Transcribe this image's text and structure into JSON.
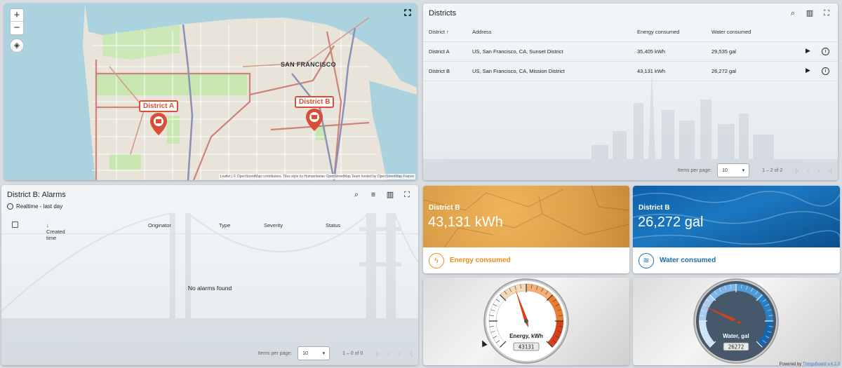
{
  "map": {
    "zoom_in": "+",
    "zoom_out": "−",
    "city_label": "SAN FRANCISCO",
    "attribution": "Leaflet | © OpenStreetMap contributors. Tiles style by Humanitarian OpenStreetMap Team hosted by OpenStreetMap France",
    "markers": [
      {
        "label": "District A"
      },
      {
        "label": "District B"
      }
    ],
    "marker_color": "#d65037"
  },
  "districts": {
    "title": "Districts",
    "columns": {
      "district": "District",
      "address": "Address",
      "energy": "Energy consumed",
      "water": "Water consumed"
    },
    "rows": [
      {
        "district": "District A",
        "address": "US, San Francisco, CA, Sunset District",
        "energy": "35,405 kWh",
        "water": "29,535 gal"
      },
      {
        "district": "District B",
        "address": "US, San Francisco, CA, Mission District",
        "energy": "43,131 kWh",
        "water": "26,272 gal"
      }
    ],
    "pagination": {
      "label": "Items per page:",
      "page_size": "10",
      "range": "1 – 2 of 2"
    }
  },
  "alarms": {
    "title": "District B: Alarms",
    "timewindow": "Realtime - last day",
    "columns": {
      "created": "Created time",
      "originator": "Originator",
      "type": "Type",
      "severity": "Severity",
      "status": "Status"
    },
    "empty": "No alarms found",
    "pagination": {
      "label": "Items per page:",
      "page_size": "10",
      "range": "1 – 0 of 0"
    }
  },
  "energy_card": {
    "district": "District B",
    "value": "43,131 kWh",
    "label": "Energy consumed",
    "color": "#f08a16"
  },
  "water_card": {
    "district": "District B",
    "value": "26,272 gal",
    "label": "Water consumed",
    "color": "#1a6ea8"
  },
  "energy_gauge": {
    "title": "Energy, kWh",
    "readout": "43131",
    "level": 0.43
  },
  "water_gauge": {
    "title": "Water, gal",
    "readout": "26272",
    "level": 0.26
  },
  "footer": {
    "powered_prefix": "Powered by",
    "brand": "ThingsBoard v.4.2.0"
  }
}
